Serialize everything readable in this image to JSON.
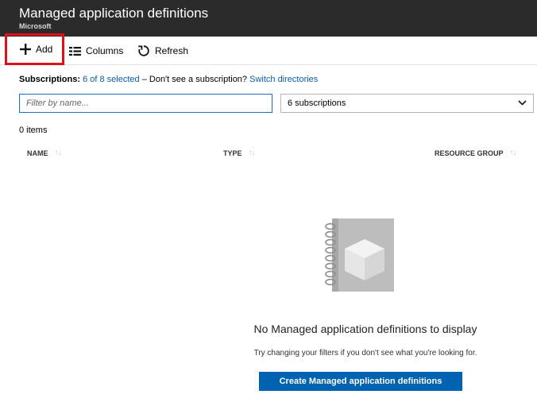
{
  "header": {
    "title": "Managed application definitions",
    "subtitle": "Microsoft"
  },
  "toolbar": {
    "add_label": "Add",
    "columns_label": "Columns",
    "refresh_label": "Refresh"
  },
  "filters": {
    "subscriptions_label": "Subscriptions:",
    "subscriptions_selected": "6 of 8 selected",
    "subscriptions_hint": "– Don't see a subscription?",
    "switch_directories": "Switch directories",
    "filter_placeholder": "Filter by name...",
    "subscription_select_value": "6 subscriptions"
  },
  "list": {
    "count_text": "0 items",
    "columns": [
      {
        "label": "NAME"
      },
      {
        "label": "TYPE"
      },
      {
        "label": "RESOURCE GROUP"
      }
    ]
  },
  "empty_state": {
    "title": "No Managed application definitions to display",
    "hint": "Try changing your filters if you don't see what you're looking for.",
    "create_button_label": "Create Managed application definitions",
    "art_icon": "notebook-cube-icon"
  },
  "colors": {
    "header_bg": "#2b2b2b",
    "link": "#0b5dad",
    "highlight_border": "#e0101a",
    "primary_button": "#0063b1"
  }
}
